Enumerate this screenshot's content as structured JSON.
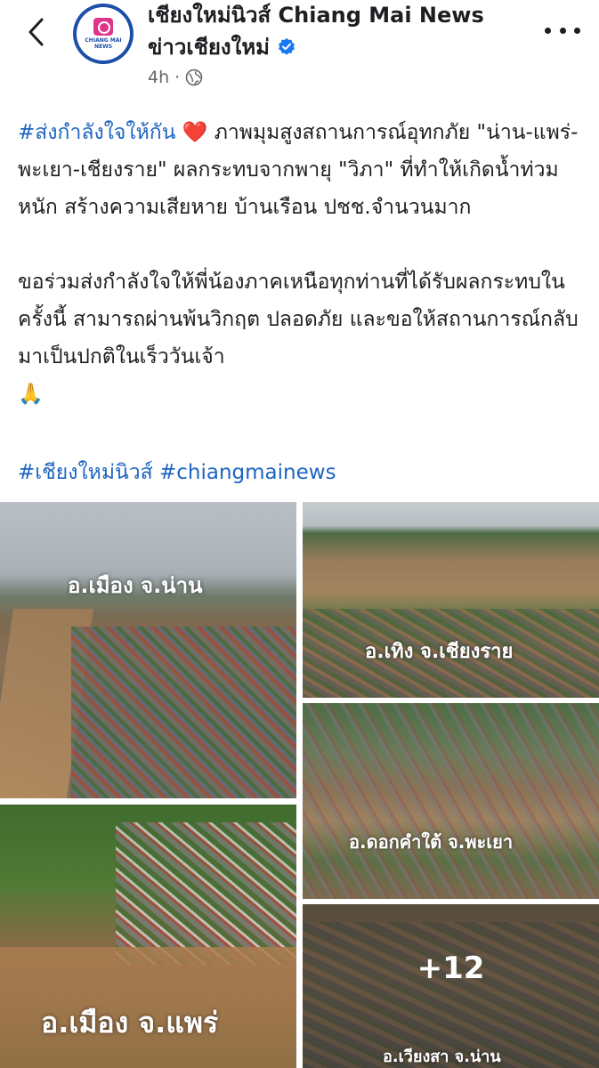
{
  "header": {
    "page_name": "เชียงใหม่นิวส์ Chiang Mai News",
    "page_subtitle": "ข่าวเชียงใหม่",
    "time_ago": "4h",
    "separator": "·",
    "avatar_text": "CHIANG MAI NEWS"
  },
  "post": {
    "para1_hashtag": "#ส่งกำลังใจให้กัน",
    "para1_emoji": "❤️",
    "para1_text": " ภาพมุมสูงสถานการณ์อุทกภัย \"น่าน-แพร่-พะเยา-เชียงราย\" ผลกระทบจากพายุ \"วิภา\" ที่ทำให้เกิดน้ำท่วมหนัก สร้างความเสียหาย บ้านเรือน ปชช.จำนวนมาก",
    "para2_text": "ขอร่วมส่งกำลังใจให้พี่น้องภาคเหนือทุกท่านที่ได้รับผลกระทบในครั้งนี้ สามารถผ่านพ้นวิกฤต ปลอดภัย และขอให้สถานการณ์กลับมาเป็นปกติในเร็ววันเจ้า",
    "para2_emoji": "🙏",
    "hashtags": [
      "#เชียงใหม่นิวส์",
      "#chiangmainews"
    ]
  },
  "photos": [
    {
      "caption": "อ.เมือง จ.น่าน"
    },
    {
      "caption": "อ.เทิง จ.เชียงราย"
    },
    {
      "caption": "อ.ดอกคำใต้ จ.พะเยา"
    },
    {
      "caption": "อ.เมือง จ.แพร่"
    },
    {
      "caption": "อ.เวียงสา จ.น่าน",
      "more_count": "+12"
    }
  ],
  "colors": {
    "hashtag": "#1d65c2",
    "verified": "#1877f2",
    "meta": "#65676b"
  },
  "icons": {
    "back": "chevron-left-icon",
    "verified": "verified-badge-icon",
    "audience": "globe-icon",
    "more": "more-options-icon"
  }
}
